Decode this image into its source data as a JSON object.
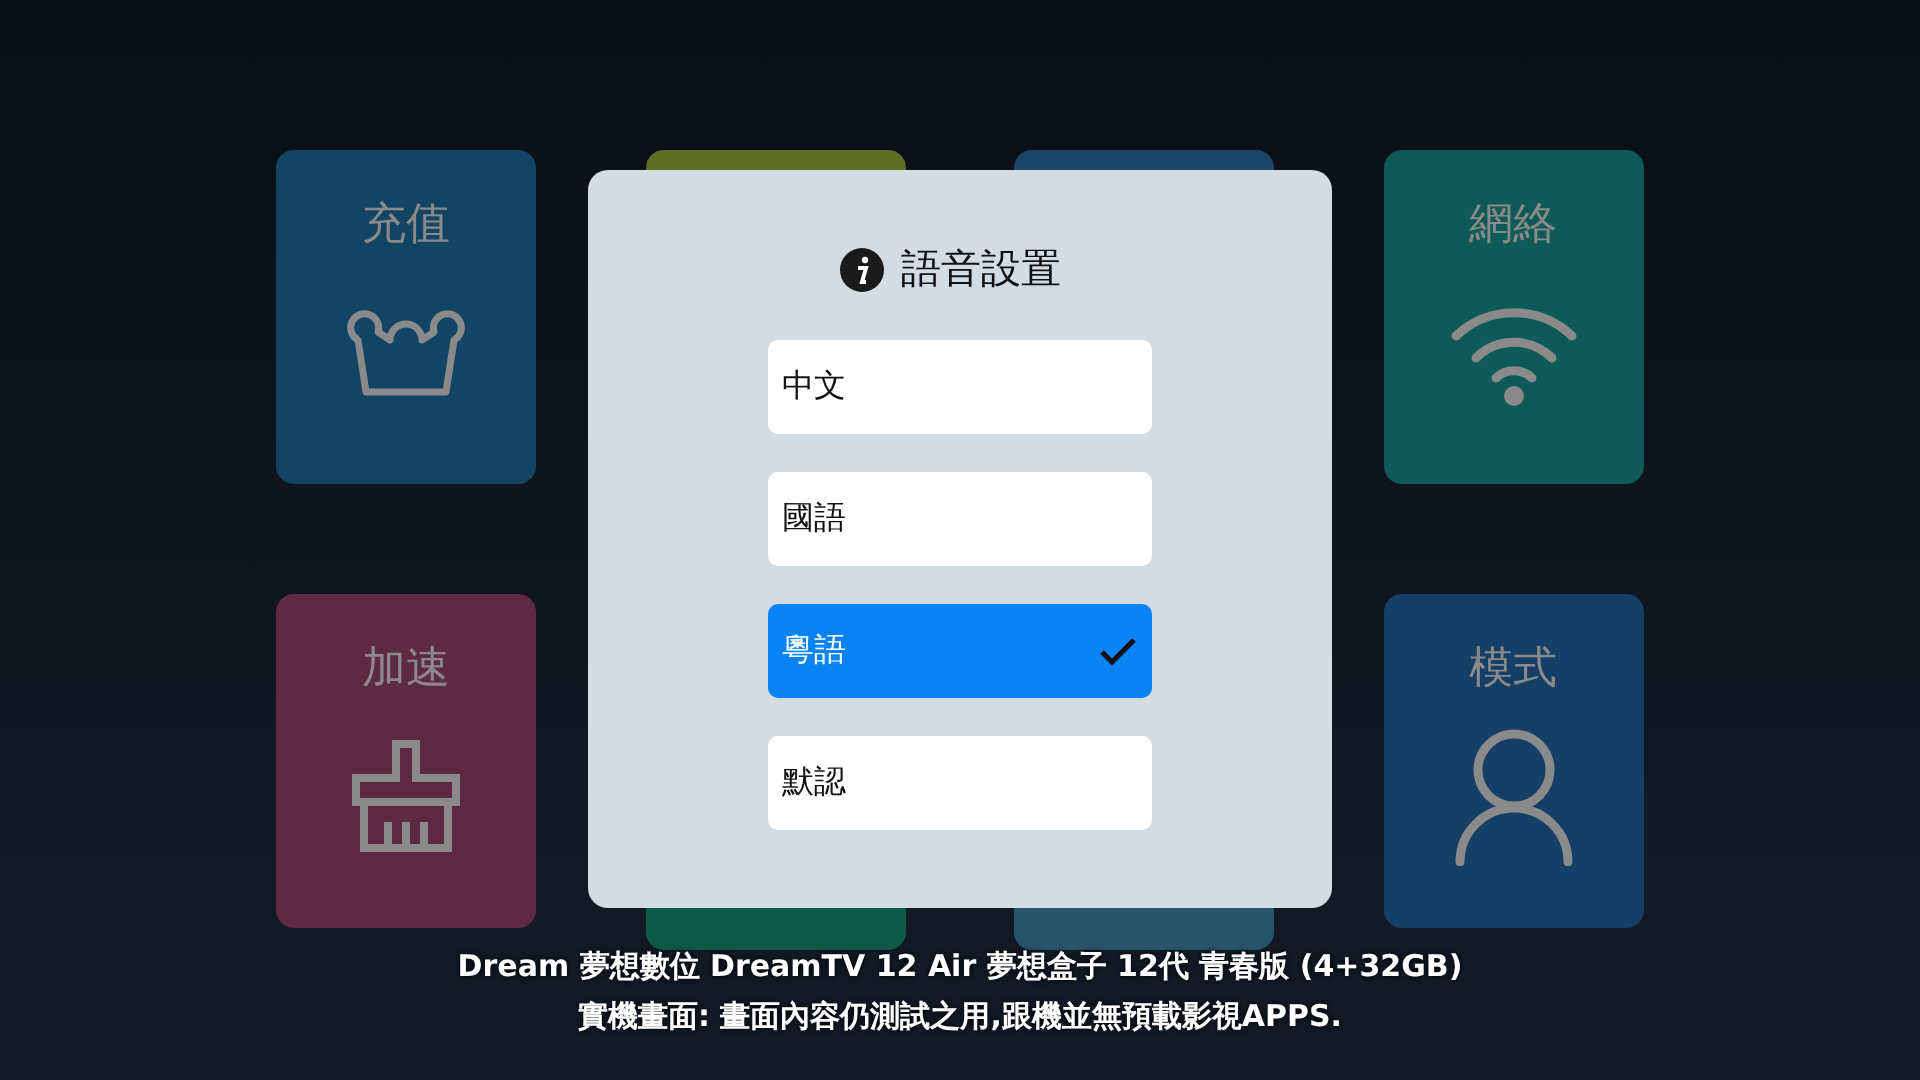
{
  "tiles": [
    {
      "kind": "vip",
      "title": "充值",
      "color": "#124564"
    },
    {
      "kind": "hidden",
      "color": "#5f6e26"
    },
    {
      "kind": "hidden",
      "color": "#1d4669"
    },
    {
      "kind": "wifi",
      "title": "網絡",
      "color": "#0e5a58"
    },
    {
      "kind": "clean",
      "title": "加速",
      "color": "#5e2a42"
    },
    {
      "kind": "hidden",
      "color": "#0c5a45"
    },
    {
      "kind": "hidden",
      "color": "#27566a"
    },
    {
      "kind": "user",
      "title": "模式",
      "color": "#153f67"
    }
  ],
  "dialog": {
    "title": "語音設置",
    "options": [
      {
        "label": "中文",
        "selected": false
      },
      {
        "label": "國語",
        "selected": false
      },
      {
        "label": "粵語",
        "selected": true
      },
      {
        "label": "默認",
        "selected": false
      }
    ]
  },
  "caption": [
    "Dream 夢想數位 DreamTV 12 Air 夢想盒子 12代 青春版 (4+32GB)",
    "實機畫面: 畫面內容仍測試之用,跟機並無預載影視APPS."
  ]
}
